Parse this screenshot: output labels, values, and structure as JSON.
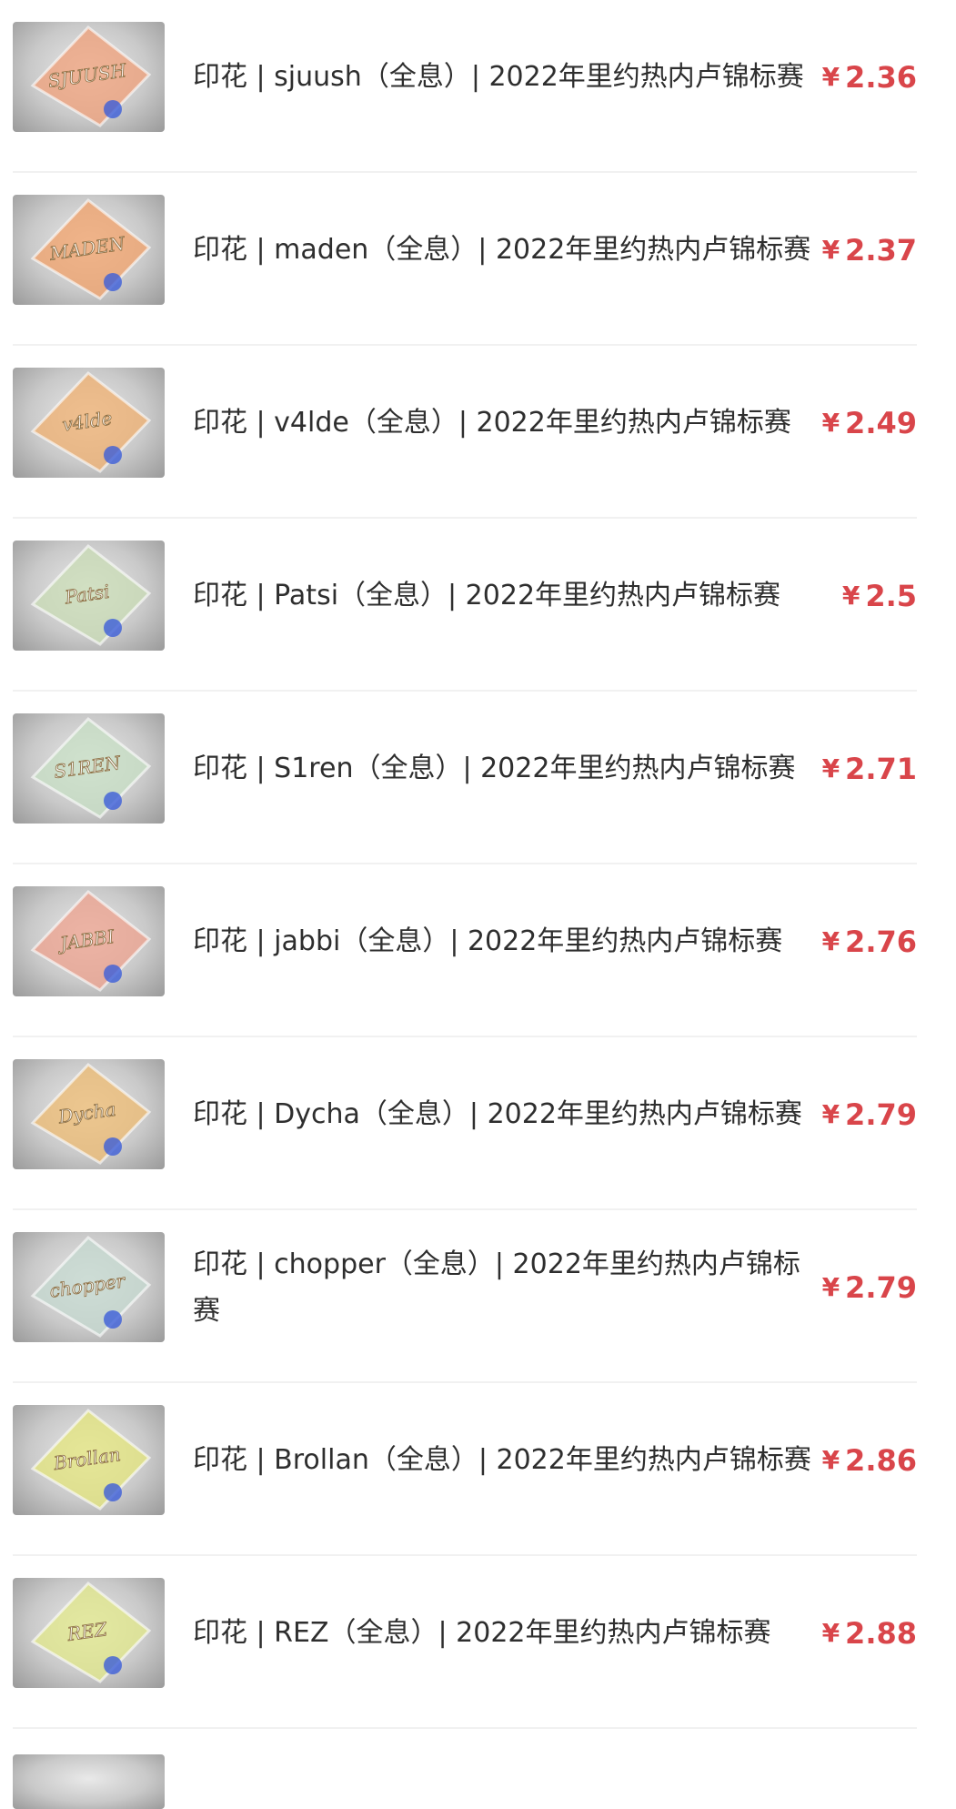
{
  "items": [
    {
      "title": "印花 | sjuush（全息）| 2022年里约热内卢锦标赛",
      "currency": "¥",
      "price": "2.36",
      "sticker_text": "SJUUSH",
      "tint": "#f0a07a"
    },
    {
      "title": "印花 | maden（全息）| 2022年里约热内卢锦标赛",
      "currency": "¥",
      "price": "2.37",
      "sticker_text": "MADEN",
      "tint": "#f2a26a"
    },
    {
      "title": "印花 | v4lde（全息）| 2022年里约热内卢锦标赛",
      "currency": "¥",
      "price": "2.49",
      "sticker_text": "v4lde",
      "tint": "#f0b070"
    },
    {
      "title": "印花 | Patsi（全息）| 2022年里约热内卢锦标赛",
      "currency": "¥",
      "price": "2.5",
      "sticker_text": "Patsi",
      "tint": "#c9dcb6"
    },
    {
      "title": "印花 | S1ren（全息）| 2022年里约热内卢锦标赛",
      "currency": "¥",
      "price": "2.71",
      "sticker_text": "S1REN",
      "tint": "#c7dfc4"
    },
    {
      "title": "印花 | jabbi（全息）| 2022年里约热内卢锦标赛",
      "currency": "¥",
      "price": "2.76",
      "sticker_text": "JABBI",
      "tint": "#eea28d"
    },
    {
      "title": "印花 | Dycha（全息）| 2022年里约热内卢锦标赛",
      "currency": "¥",
      "price": "2.79",
      "sticker_text": "Dycha",
      "tint": "#eebb72"
    },
    {
      "title": "印花 | chopper（全息）| 2022年里约热内卢锦标赛",
      "currency": "¥",
      "price": "2.79",
      "sticker_text": "chopper",
      "tint": "#c4d8cf"
    },
    {
      "title": "印花 | Brollan（全息）| 2022年里约热内卢锦标赛",
      "currency": "¥",
      "price": "2.86",
      "sticker_text": "Brollan",
      "tint": "#e4e57c"
    },
    {
      "title": "印花 | REZ（全息）| 2022年里约热内卢锦标赛",
      "currency": "¥",
      "price": "2.88",
      "sticker_text": "REZ",
      "tint": "#e2e88a"
    }
  ],
  "colors": {
    "price": "#d9454a",
    "divider": "#f1f1f1"
  }
}
